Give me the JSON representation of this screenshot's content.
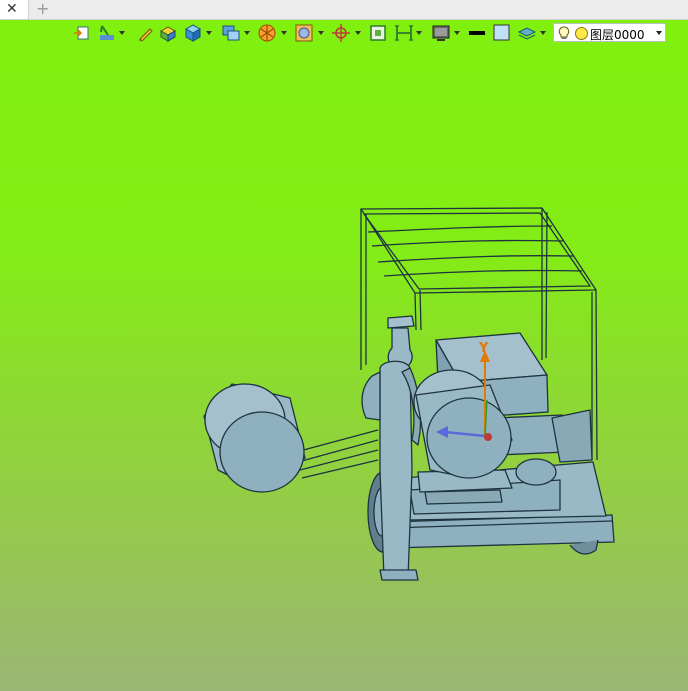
{
  "tab": {
    "close_icon": "close-icon",
    "add_icon": "plus-icon"
  },
  "viewport": {
    "gradient_top": "#80f00f",
    "gradient_bottom": "#9ab775"
  },
  "toolbar": {
    "icons": [
      "import-icon",
      "sketch-icon",
      "pencil-icon",
      "solid-icon",
      "cube-icon",
      "view-icon",
      "section-icon",
      "render-icon",
      "snap-icon",
      "select-icon",
      "frame-icon",
      "display-icon",
      "line-color-icon",
      "fill-color-icon",
      "layer-icon"
    ],
    "layer": {
      "name": "图层0000",
      "bulb_icon": "lightbulb-icon",
      "color": "#ffe84a"
    }
  },
  "axis": {
    "y_label": "Y"
  },
  "model": {
    "color": "#8fb1bf",
    "outline": "#1e3340"
  }
}
